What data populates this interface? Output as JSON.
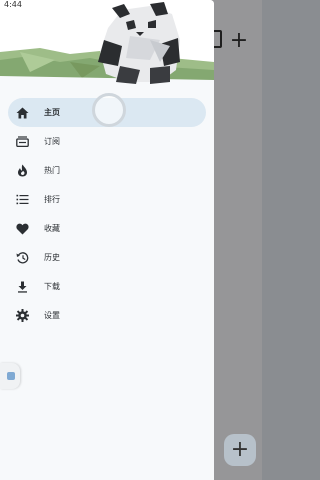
{
  "status_bar": {
    "time": "4:44",
    "icons": "▾◢▮"
  },
  "background_app": {
    "plus_label": "+",
    "fab_label": "+"
  },
  "menu": {
    "items": [
      {
        "label": "主页",
        "icon": "home-icon",
        "active": true
      },
      {
        "label": "订阅",
        "icon": "subscription-icon",
        "active": false
      },
      {
        "label": "热门",
        "icon": "fire-icon",
        "active": false
      },
      {
        "label": "排行",
        "icon": "ranking-list-icon",
        "active": false
      },
      {
        "label": "收藏",
        "icon": "heart-icon",
        "active": false
      },
      {
        "label": "历史",
        "icon": "history-icon",
        "active": false
      },
      {
        "label": "下载",
        "icon": "download-icon",
        "active": false
      },
      {
        "label": "设置",
        "icon": "gear-icon",
        "active": false
      }
    ]
  },
  "colors": {
    "active_bg": "#dbe8f2",
    "grass": "#8fb07a",
    "scrim": "rgba(0,0,0,0.38)"
  }
}
